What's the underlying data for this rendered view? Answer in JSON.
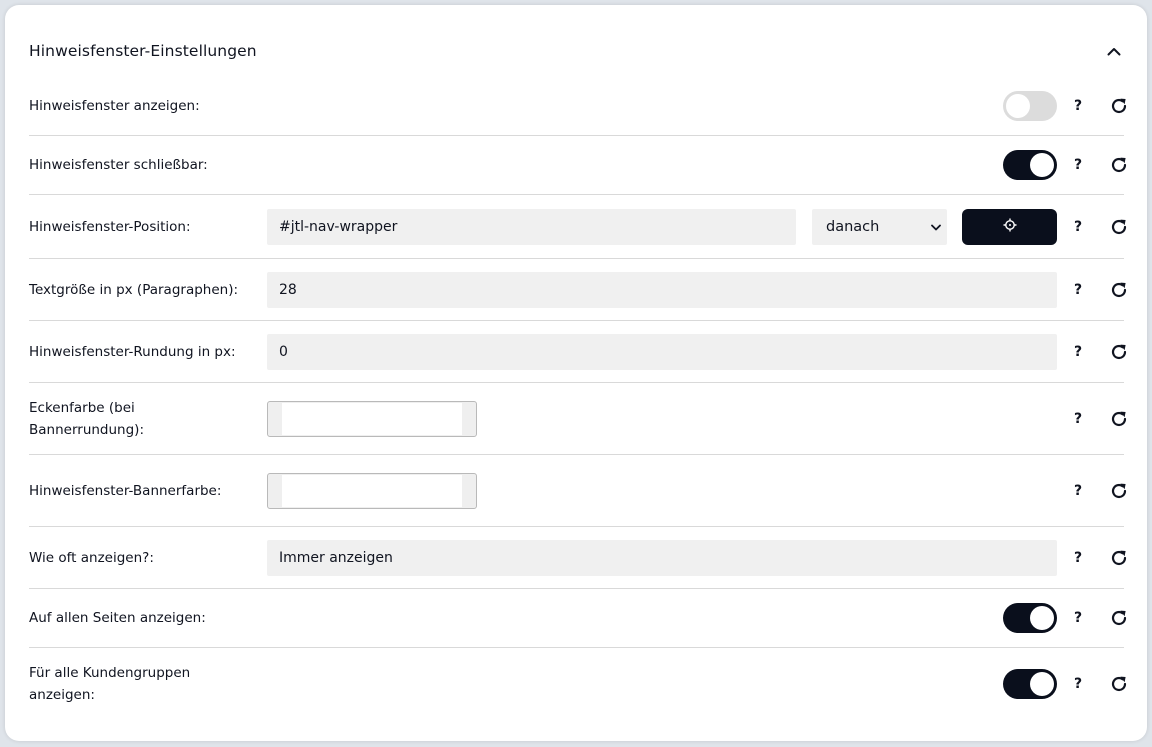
{
  "header": {
    "title": "Hinweisfenster-Einstellungen"
  },
  "actions": {
    "help_label": "?"
  },
  "rows": {
    "show": {
      "label": "Hinweisfenster anzeigen:",
      "enabled": false
    },
    "closable": {
      "label": "Hinweisfenster schließbar:",
      "enabled": true
    },
    "position": {
      "label": "Hinweisfenster-Position:",
      "selector": "#jtl-nav-wrapper",
      "placement": "danach"
    },
    "textsize": {
      "label": "Textgröße in px (Paragraphen):",
      "value": "28"
    },
    "rounding": {
      "label": "Hinweisfenster-Rundung in px:",
      "value": "0"
    },
    "cornercolor": {
      "label": "Eckenfarbe (bei Bannerrundung):",
      "color": "#ffffff"
    },
    "bannercolor": {
      "label": "Hinweisfenster-Bannerfarbe:",
      "color": "#ffffff"
    },
    "frequency": {
      "label": "Wie oft anzeigen?:",
      "value": "Immer anzeigen"
    },
    "allpages": {
      "label": "Auf allen Seiten anzeigen:",
      "enabled": true
    },
    "allgroups": {
      "label": "Für alle Kundengruppen anzeigen:",
      "enabled": true
    }
  },
  "colors": {
    "accent": "#0a0f1c",
    "toggle_off": "#dcdcdc",
    "field_bg": "#f0f0f0",
    "divider": "#d9d9d9"
  }
}
